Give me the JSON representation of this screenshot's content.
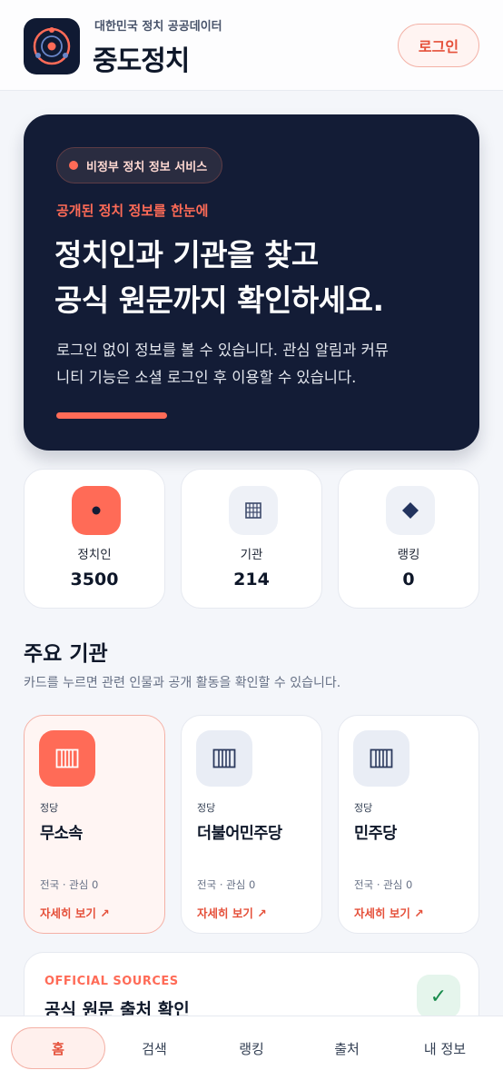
{
  "header": {
    "subtitle": "대한민국 정치 공공데이터",
    "title": "중도정치",
    "login_label": "로그인"
  },
  "hero": {
    "badge": "비정부 정치 정보 서비스",
    "kicker": "공개된 정치 정보를 한눈에",
    "title_line1": "정치인과 기관을 찾고",
    "title_line2": "공식 원문까지 확인하세요.",
    "desc_line1": "로그인 없이 정보를 볼 수 있습니다. 관심 알림과 커뮤",
    "desc_line2": "니티 기능은 소셜 로그인 후 이용할 수 있습니다."
  },
  "stats": [
    {
      "label": "정치인",
      "value": "3500",
      "icon": "dot-icon"
    },
    {
      "label": "기관",
      "value": "214",
      "icon": "grid-icon"
    },
    {
      "label": "랭킹",
      "value": "0",
      "icon": "diamond-icon"
    }
  ],
  "section": {
    "title": "주요 기관",
    "desc": "카드를 누르면 관련 인물과 공개 활동을 확인할 수 있습니다."
  },
  "orgs": [
    {
      "type": "정당",
      "name": "무소속",
      "meta": "전국 · 관심 0",
      "link": "자세히 보기 ↗"
    },
    {
      "type": "정당",
      "name": "더불어민주당",
      "meta": "전국 · 관심 0",
      "link": "자세히 보기 ↗"
    },
    {
      "type": "정당",
      "name": "민주당",
      "meta": "전국 · 관심 0",
      "link": "자세히 보기 ↗"
    }
  ],
  "sources": {
    "kicker": "OFFICIAL SOURCES",
    "title": "공식 원문 출처 확인",
    "check": "✓"
  },
  "nav": [
    {
      "label": "홈"
    },
    {
      "label": "검색"
    },
    {
      "label": "랭킹"
    },
    {
      "label": "출처"
    },
    {
      "label": "내 정보"
    }
  ],
  "colors": {
    "accent": "#ff6b57",
    "navy": "#131c36",
    "background": "#f4f6fa"
  }
}
